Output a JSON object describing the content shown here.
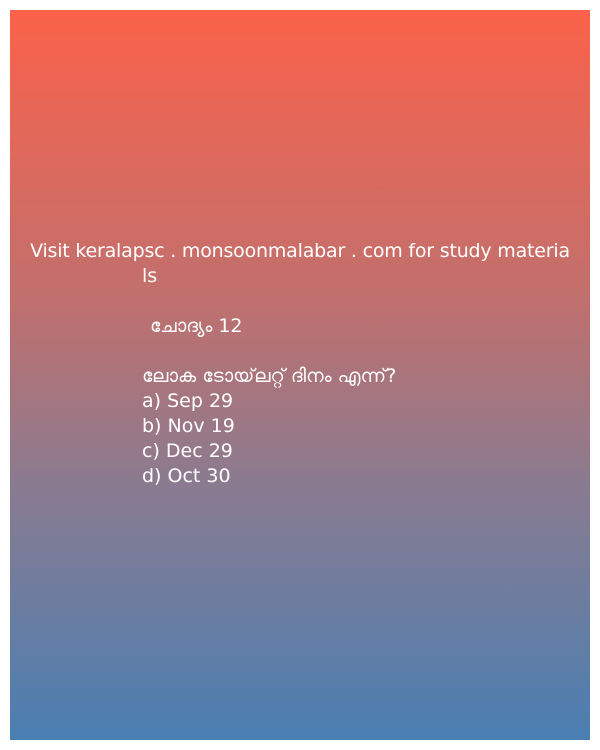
{
  "promo": {
    "line1": "Visit keralapsc . monsoonmalabar . com for study materia",
    "line2": "ls"
  },
  "question": {
    "number_label": "ചോദ്യം 12",
    "text": "ലോക ടോയ്‌ലറ്റ് ദിനം എന്ന്?",
    "options": [
      "a) Sep 29",
      "b) Nov 19",
      "c) Dec 29",
      "d) Oct 30"
    ]
  },
  "colors": {
    "gradient_top": "#fb624a",
    "gradient_bottom": "#4a7fb2",
    "text": "#ffffff"
  }
}
